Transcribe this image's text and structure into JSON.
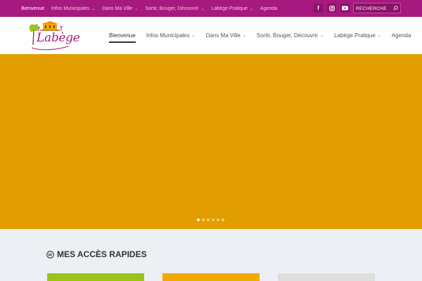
{
  "topbar": {
    "bg": "#a6197f",
    "items": [
      {
        "label": "Bienvenue",
        "dropdown": false,
        "active": true
      },
      {
        "label": "Infos Municipales",
        "dropdown": true
      },
      {
        "label": "Dans Ma Ville",
        "dropdown": true
      },
      {
        "label": "Sortir, Bouger, Découvrir",
        "dropdown": true
      },
      {
        "label": "Labège Pratique",
        "dropdown": true
      },
      {
        "label": "Agenda",
        "dropdown": false
      }
    ],
    "social": [
      {
        "icon": "facebook-icon",
        "glyph": "f"
      },
      {
        "icon": "instagram-icon",
        "glyph": ""
      },
      {
        "icon": "youtube-icon",
        "glyph": ""
      }
    ],
    "search": {
      "placeholder": "RECHERCHE"
    }
  },
  "header": {
    "logo_text": "Labège",
    "nav": [
      {
        "label": "Bienvenue",
        "dropdown": false,
        "active": true
      },
      {
        "label": "Infos Municipales",
        "dropdown": true
      },
      {
        "label": "Dans Ma Ville",
        "dropdown": true
      },
      {
        "label": "Sortir, Bouger, Découvrir",
        "dropdown": true
      },
      {
        "label": "Labège Pratique",
        "dropdown": true
      },
      {
        "label": "Agenda",
        "dropdown": false
      }
    ]
  },
  "hero": {
    "bg": "#e29d00",
    "slides": 6,
    "active_slide": 1
  },
  "quick_access": {
    "title": "MES ACCÈS RAPIDES",
    "icon": "quote-icon",
    "tiles": [
      {
        "color": "#9bc31c"
      },
      {
        "color": "#f2a900"
      },
      {
        "color": "#dedede"
      }
    ]
  }
}
